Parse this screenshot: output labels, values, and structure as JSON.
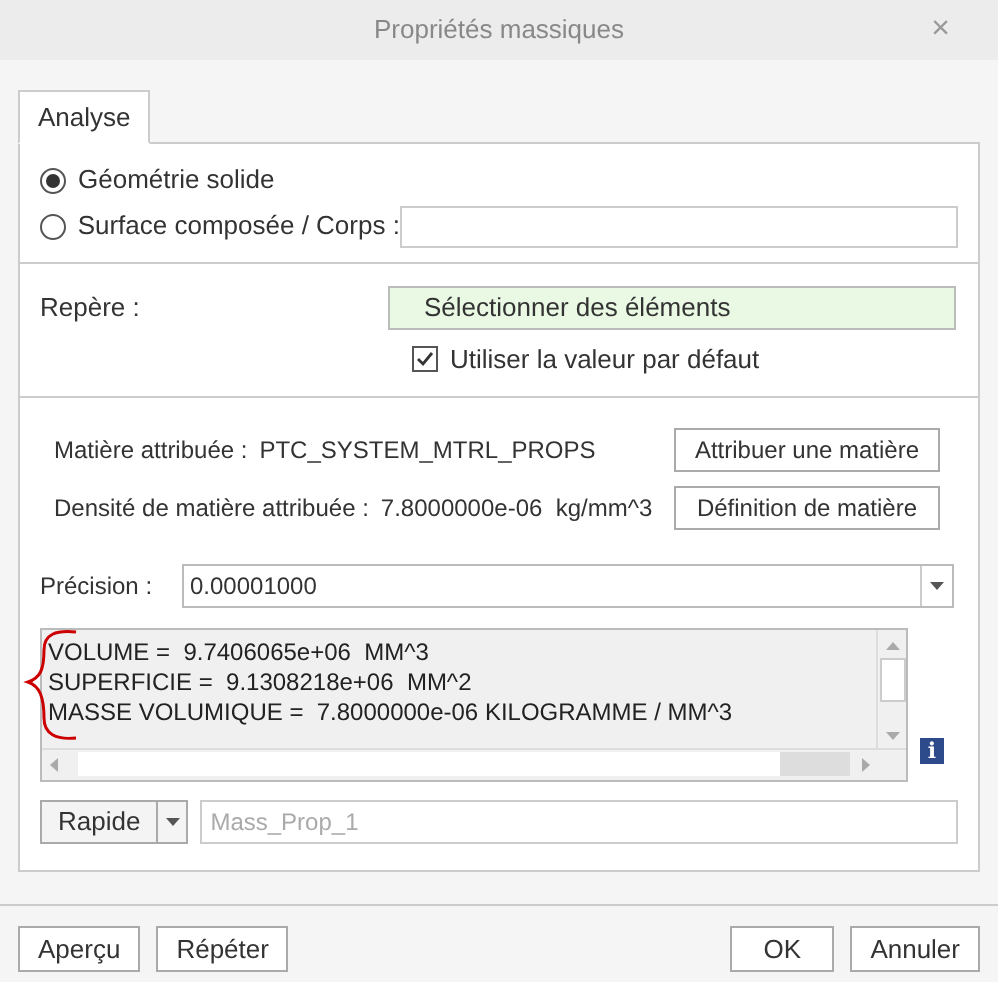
{
  "window": {
    "title": "Propriétés massiques",
    "close": "×"
  },
  "tabs": [
    {
      "label": "Analyse",
      "selected": true
    }
  ],
  "geometry_options": [
    {
      "label": "Géométrie solide",
      "selected": true
    },
    {
      "label": "Surface composée / Corps :",
      "selected": false
    }
  ],
  "repere": {
    "label": "Repère :",
    "button": "Sélectionner des éléments",
    "use_default": {
      "label": "Utiliser la valeur par défaut",
      "checked": true
    }
  },
  "material": {
    "assigned_label": "Matière attribuée :",
    "assigned_value": "PTC_SYSTEM_MTRL_PROPS",
    "assign_button": "Attribuer une matière",
    "density_label": "Densité de matière attribuée :",
    "density_value": "7.8000000e-06  kg/mm^3",
    "definition_button": "Définition de matière"
  },
  "precision": {
    "label": "Précision :",
    "value": "0.00001000"
  },
  "results": [
    "VOLUME =  9.7406065e+06  MM^3",
    "SUPERFICIE =  9.1308218e+06  MM^2",
    "MASSE VOLUMIQUE =  7.8000000e-06 KILOGRAMME / MM^3"
  ],
  "info_icon": "i",
  "save": {
    "mode": "Rapide",
    "placeholder": "Mass_Prop_1"
  },
  "footer_buttons": [
    {
      "label": "Aperçu",
      "kind": "left"
    },
    {
      "label": "Répéter",
      "kind": "left"
    },
    {
      "label": "OK",
      "kind": "right"
    },
    {
      "label": "Annuler",
      "kind": "right"
    }
  ]
}
